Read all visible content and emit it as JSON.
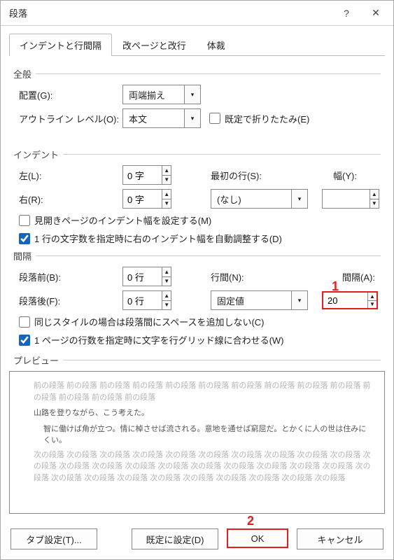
{
  "window": {
    "title": "段落"
  },
  "tabs": {
    "t1": "インデントと行間隔",
    "t2": "改ページと改行",
    "t3": "体裁"
  },
  "general": {
    "title": "全般",
    "alignment_label": "配置(G):",
    "alignment_value": "両端揃え",
    "outline_label": "アウトライン レベル(O):",
    "outline_value": "本文",
    "collapse_label": "既定で折りたたみ(E)"
  },
  "indent": {
    "title": "インデント",
    "left_label": "左(L):",
    "left_value": "0 字",
    "right_label": "右(R):",
    "right_value": "0 字",
    "firstline_label": "最初の行(S):",
    "firstline_value": "(なし)",
    "width_label": "幅(Y):",
    "width_value": "",
    "mirror_label": "見開きページのインデント幅を設定する(M)",
    "autoadjust_label": "1 行の文字数を指定時に右のインデント幅を自動調整する(D)"
  },
  "spacing": {
    "title": "間隔",
    "before_label": "段落前(B):",
    "before_value": "0 行",
    "after_label": "段落後(F):",
    "after_value": "0 行",
    "linespacing_label": "行間(N):",
    "linespacing_value": "固定値",
    "at_label": "間隔(A):",
    "at_value": "20",
    "samestyle_label": "同じスタイルの場合は段落間にスペースを追加しない(C)",
    "snapgrid_label": "1 ページの行数を指定時に文字を行グリッド線に合わせる(W)"
  },
  "preview": {
    "title": "プレビュー",
    "prev_label": "前の段落",
    "sample1": "山路を登りながら、こう考えた。",
    "sample2": "智に働けば角が立つ。情に棹させば流される。意地を通せば窮屈だ。とかくに人の世は住みにくい。",
    "next_label": "次の段落"
  },
  "buttons": {
    "tabs": "タブ設定(T)...",
    "default": "既定に設定(D)",
    "ok": "OK",
    "cancel": "キャンセル"
  },
  "markers": {
    "m1": "1",
    "m2": "2"
  }
}
